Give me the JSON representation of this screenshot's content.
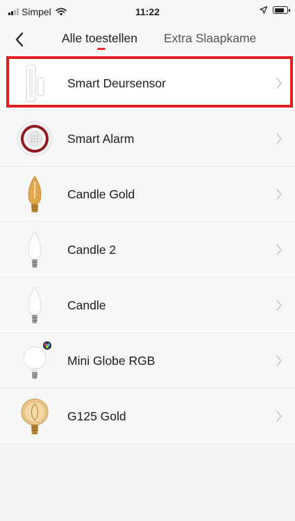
{
  "status_bar": {
    "carrier": "Simpel",
    "time": "11:22"
  },
  "nav": {
    "tabs": [
      {
        "label": "Alle toestellen",
        "active": true
      },
      {
        "label": "Extra Slaapkame",
        "active": false
      }
    ]
  },
  "devices": [
    {
      "name": "Smart Deursensor",
      "icon": "door-sensor-icon",
      "selected": true
    },
    {
      "name": "Smart Alarm",
      "icon": "siren-icon"
    },
    {
      "name": "Candle Gold",
      "icon": "candle-gold-bulb-icon"
    },
    {
      "name": "Candle 2",
      "icon": "candle-bulb-icon"
    },
    {
      "name": "Candle",
      "icon": "candle-bulb-icon"
    },
    {
      "name": "Mini Globe RGB",
      "icon": "globe-rgb-bulb-icon"
    },
    {
      "name": "G125 Gold",
      "icon": "g125-gold-bulb-icon"
    }
  ],
  "colors": {
    "accent": "#f02d2d",
    "highlight": "#e02020",
    "background": "#f5f5f7"
  }
}
